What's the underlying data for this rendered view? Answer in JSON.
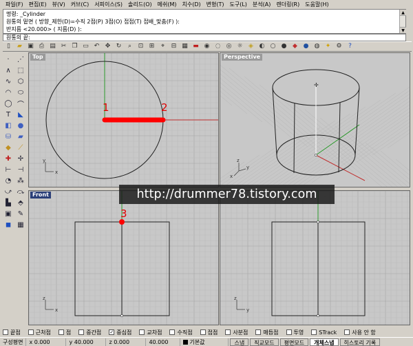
{
  "menu": [
    "파일(F)",
    "편집(E)",
    "뷰(V)",
    "커브(C)",
    "서피이스(S)",
    "솔리드(O)",
    "메쉬(M)",
    "치수(D)",
    "변형(T)",
    "도구(L)",
    "분석(A)",
    "렌더링(R)",
    "도움말(H)"
  ],
  "command_history": [
    "명령: _Cylinder",
    "원통의 밑면 ( 방향_제한(D)=수직 2점(P) 3점(O) 접점(T) 접배_맞춤(F) ):",
    "반지름 <20.000> ( 지름(D) ):"
  ],
  "command_prompt": "원통의 끝:",
  "viewports": {
    "top": {
      "title": "Top",
      "point1_label": "1",
      "point2_label": "2",
      "axis_x": "x",
      "axis_y": "y"
    },
    "perspective": {
      "title": "Perspective",
      "axis_x": "x",
      "axis_y": "y",
      "axis_z": "z"
    },
    "front": {
      "title": "Front",
      "point3_label": "3",
      "axis_x": "x",
      "axis_z": "z"
    },
    "right": {
      "title": "",
      "axis_y": "y",
      "axis_z": "z"
    }
  },
  "watermark": "http://drummer78.tistory.com",
  "osnaps": [
    {
      "label": "끝점",
      "checked": false
    },
    {
      "label": "근처점",
      "checked": false
    },
    {
      "label": "점",
      "checked": false
    },
    {
      "label": "중간점",
      "checked": false
    },
    {
      "label": "중심점",
      "checked": true
    },
    {
      "label": "교차점",
      "checked": false
    },
    {
      "label": "수직점",
      "checked": false
    },
    {
      "label": "접점",
      "checked": false
    },
    {
      "label": "사분점",
      "checked": false
    },
    {
      "label": "매듭점",
      "checked": false
    },
    {
      "label": "투영",
      "checked": false
    },
    {
      "label": "STrack",
      "checked": false
    },
    {
      "label": "사용 안 함",
      "checked": false
    }
  ],
  "status": {
    "cplane": "구성평면",
    "x": "x 0.000",
    "y": "y 40.000",
    "z": "z 0.000",
    "length": "40.000",
    "layer": "기본값",
    "snap": "스냅",
    "ortho": "직교모드",
    "planar": "평면모드",
    "osnap": "개체스냅",
    "history": "히스토리 기록"
  },
  "colors": {
    "viewport_bg": "#c8c8c8",
    "grid_minor": "#bbbbbb",
    "grid_major": "#a4a4a4",
    "axis_x": "#c03030",
    "axis_y": "#2c9a2c",
    "highlight": "#ff0000",
    "active_title": "#2a3e78"
  },
  "toolbar_icons": [
    "new-icon",
    "open-icon",
    "save-icon",
    "print-icon",
    "import-icon",
    "cut-icon",
    "copy-icon",
    "paste-icon",
    "undo-icon",
    "pan-icon",
    "rotate-view-icon",
    "zoom-icon",
    "zoom-window-icon",
    "zoom-extents-icon",
    "zoom-selected-icon",
    "4-views-icon",
    "cplane-icon",
    "camera-icon",
    "point-on-icon",
    "select-icon",
    "hide-icon",
    "lock-icon",
    "layer-icon",
    "properties-icon",
    "wireframe-icon",
    "shaded-icon",
    "rendered-icon",
    "render-icon",
    "material-icon",
    "light-icon",
    "options-icon",
    "help-icon"
  ],
  "left_tools": [
    "point-tool-icon",
    "polyline-tool-icon",
    "line-tool-icon",
    "rectangle-tool-icon",
    "curve-tool-icon",
    "polygon-tool-icon",
    "arc-tool-icon",
    "ellipse-tool-icon",
    "circle-tool-icon",
    "fillet-tool-icon",
    "text-tool-icon",
    "surface-tool-icon",
    "box-tool-icon",
    "sphere-tool-icon",
    "cylinder-tool-icon",
    "extrude-tool-icon",
    "mesh-tool-icon",
    "dimension-tool-icon",
    "boolean-tool-icon",
    "explode-tool-icon",
    "trim-tool-icon",
    "split-tool-icon",
    "join-tool-icon",
    "group-tool-icon",
    "move-tool-icon",
    "copy-tool-icon",
    "array-tool-icon",
    "mirror-tool-icon",
    "block-tool-icon",
    "analyze-tool-icon",
    "render-tool-icon",
    "grid-tool-icon"
  ]
}
